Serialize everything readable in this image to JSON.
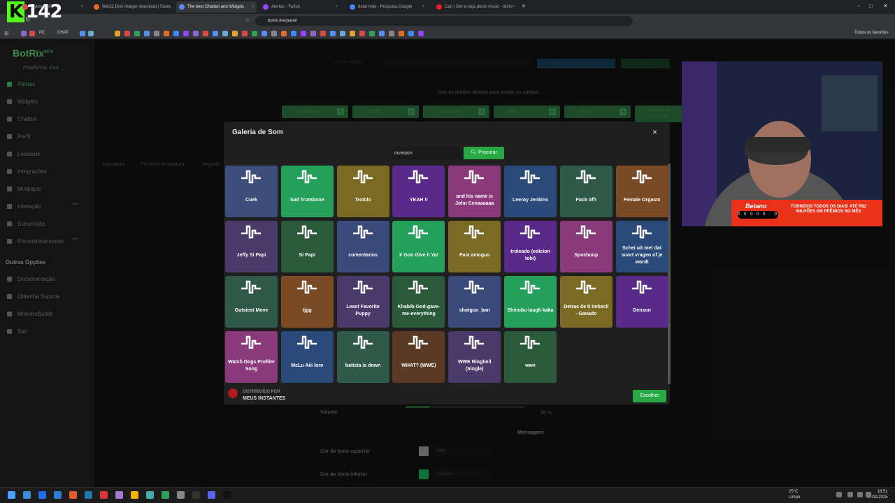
{
  "browser": {
    "tabs": [
      {
        "label": "...ybrary of t",
        "color": "#d94a4a"
      },
      {
        "label": "Win32 Disk Imager download | Sourc",
        "color": "#e26a2c"
      },
      {
        "label": "The best Chatbot and Widgets",
        "color": "#5a8df0"
      },
      {
        "label": "Alertas - Twitch",
        "color": "#9146ff"
      },
      {
        "label": "dolar hoje - Pesquisa Google",
        "color": "#4285f4"
      },
      {
        "label": "Can I Get a raça doom music - Itoris",
        "color": "#e02020"
      }
    ],
    "url": "botrix.live/panel",
    "bookmarks": [
      "PC",
      "CHAT"
    ],
    "all_bookmarks": "Todos os favoritos"
  },
  "overlay": {
    "kick_badge": "K",
    "viewers": "142"
  },
  "sidebar": {
    "logo": "BotRix",
    "beta": "BETA",
    "platform_label": "Plataforma:",
    "platform_value": "Kick",
    "items": [
      {
        "label": "Alertas"
      },
      {
        "label": "Widgets"
      },
      {
        "label": "Chatbot"
      },
      {
        "label": "Perfil"
      },
      {
        "label": "Lealdade"
      },
      {
        "label": "Integrações"
      },
      {
        "label": "Minijogos"
      },
      {
        "label": "Interação",
        "badge": "NEW"
      },
      {
        "label": "Subscrição"
      },
      {
        "label": "Encaminhamentos",
        "badge": "NEW"
      }
    ],
    "other_heading": "Outras Opções",
    "other_items": [
      {
        "label": "Documentação"
      },
      {
        "label": "Obtenha Suporte"
      },
      {
        "label": "MonsterBuilds"
      },
      {
        "label": "Sair"
      }
    ]
  },
  "background": {
    "widget_url_label": "Url do widget:",
    "advanced_btn": "Configurações avançadas",
    "copy_btn": "Copiar",
    "test_hint": "Use os botões abaixo para testar os alertas:",
    "test_buttons": [
      "Assinatura",
      "Oferta",
      "Seguidores",
      "Host",
      "KICKs",
      "Presente de Assinatura"
    ],
    "tabs": [
      "Assinatura",
      "Presente Assinatura",
      "Seguido"
    ],
    "volume_label": "Volume",
    "volume_value": "20 %",
    "volume_level": 0.2,
    "message_heading": "Mensagem:",
    "upper_text_color_label": "Cor do texto superior",
    "upper_text_color": "#ffffff",
    "lower_text_color_label": "Cor do texto inferior",
    "lower_text_color": "#19d66b"
  },
  "modal": {
    "title": "Galeria de Som",
    "close": "×",
    "search_value": "invasion",
    "search_button": "Procurar",
    "powered_small": "DISTRIBUÍDO POR",
    "powered_name": "MEUS INSTANTES",
    "choose_button": "Escolher",
    "sounds": [
      {
        "label": "Cuek",
        "color": "#3d4d7a"
      },
      {
        "label": "Sad Trombone",
        "color": "#24a05a"
      },
      {
        "label": "Trololo",
        "color": "#7a6a24"
      },
      {
        "label": "YEAH !!",
        "color": "#5a2a8a"
      },
      {
        "label": "and his name is John Cenaaaaaa",
        "color": "#8a3a7a"
      },
      {
        "label": "Leeroy Jenkins",
        "color": "#2a4a7a"
      },
      {
        "label": "Fuck off!",
        "color": "#2f5a4a"
      },
      {
        "label": "Female Orgasm",
        "color": "#7a4a24"
      },
      {
        "label": "Jeffy Si Papi",
        "color": "#4a3a6a"
      },
      {
        "label": "Si Papi",
        "color": "#2a5a3a"
      },
      {
        "label": "comentarios",
        "color": "#3a4a7a"
      },
      {
        "label": "X Gon Give it Ya!",
        "color": "#24a05a"
      },
      {
        "label": "Fast amogus",
        "color": "#7a6a24"
      },
      {
        "label": "troleado (edicion tobi)",
        "color": "#5a2a8a"
      },
      {
        "label": "Speeboop",
        "color": "#8a3a7a"
      },
      {
        "label": "Schei uit met dat soort vragen of je wordt",
        "color": "#2a4a7a"
      },
      {
        "label": "Gutsiest Move",
        "color": "#2f5a4a"
      },
      {
        "label": "tjgg",
        "color": "#7a4a24"
      },
      {
        "label": "Least Favorite Puppy",
        "color": "#4a3a6a"
      },
      {
        "label": "Khabib-God-gave-me-everything",
        "color": "#2a5a3a"
      },
      {
        "label": "shotgun_ban",
        "color": "#3a4a7a"
      },
      {
        "label": "Shinobu laugh kaka",
        "color": "#24a05a"
      },
      {
        "label": "Detras de ti imbecil - Ganado",
        "color": "#7a6a24"
      },
      {
        "label": "Denson",
        "color": "#5a2a8a"
      },
      {
        "label": "Watch Dogs Profiler Song",
        "color": "#8a3a7a"
      },
      {
        "label": "McLu Aiii loro",
        "color": "#2a4a7a"
      },
      {
        "label": "batista is down",
        "color": "#2f5a4a"
      },
      {
        "label": "WHAT? (WWE)",
        "color": "#5a3a24"
      },
      {
        "label": "WWE Ringbell (Single)",
        "color": "#4a3a6a"
      },
      {
        "label": "wwe",
        "color": "#2a5a3a"
      }
    ]
  },
  "ad": {
    "brand": "Betano",
    "bar": "0 0 0 0 0 : 0",
    "text": "TORNEIOS TODOS OS DIAS! ATÉ R$2 MILHÕES EM PRÊMIOS NO MÊS"
  },
  "taskbar": {
    "temp": "25°C",
    "condition": "Limpo",
    "time": "18:51",
    "date": "07/11/2025"
  }
}
